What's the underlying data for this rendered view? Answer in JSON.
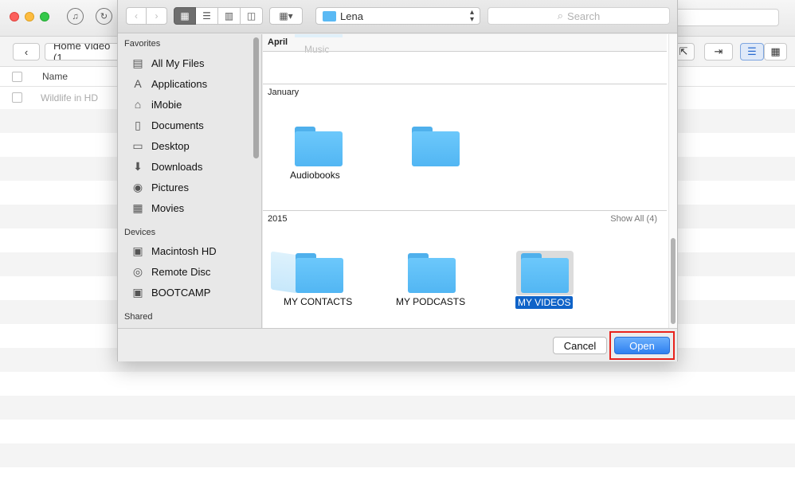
{
  "background_app": {
    "breadcrumb": "Home Video (1",
    "table": {
      "column_name": "Name",
      "rows": [
        "Wildlife in HD"
      ]
    }
  },
  "dialog": {
    "path": "Lena",
    "search_placeholder": "Search",
    "sidebar": {
      "sections": [
        {
          "title": "Favorites",
          "items": [
            {
              "label": "All My Files",
              "icon": "all-files-icon"
            },
            {
              "label": "Applications",
              "icon": "applications-icon"
            },
            {
              "label": "iMobie",
              "icon": "home-icon"
            },
            {
              "label": "Documents",
              "icon": "documents-icon"
            },
            {
              "label": "Desktop",
              "icon": "desktop-icon"
            },
            {
              "label": "Downloads",
              "icon": "downloads-icon"
            },
            {
              "label": "Pictures",
              "icon": "camera-icon"
            },
            {
              "label": "Movies",
              "icon": "film-icon"
            }
          ]
        },
        {
          "title": "Devices",
          "items": [
            {
              "label": "Macintosh HD",
              "icon": "hard-drive-icon"
            },
            {
              "label": "Remote Disc",
              "icon": "disc-icon"
            },
            {
              "label": "BOOTCAMP",
              "icon": "hard-drive-icon"
            }
          ]
        },
        {
          "title": "Shared",
          "items": []
        }
      ]
    },
    "groups": [
      {
        "title": "April",
        "items": [
          "Music"
        ]
      },
      {
        "title": "January",
        "items": [
          "Audiobooks"
        ]
      },
      {
        "title": "2015",
        "show_all": "Show All (4)",
        "items": [
          "MY CONTACTS",
          "MY PODCASTS",
          "MY VIDEOS"
        ],
        "selected": "MY VIDEOS"
      }
    ],
    "buttons": {
      "cancel": "Cancel",
      "open": "Open"
    }
  },
  "colors": {
    "accent": "#2f80f0",
    "selection": "#0f63c8",
    "highlight_box": "#e8231d",
    "folder": "#5ab9f4"
  }
}
